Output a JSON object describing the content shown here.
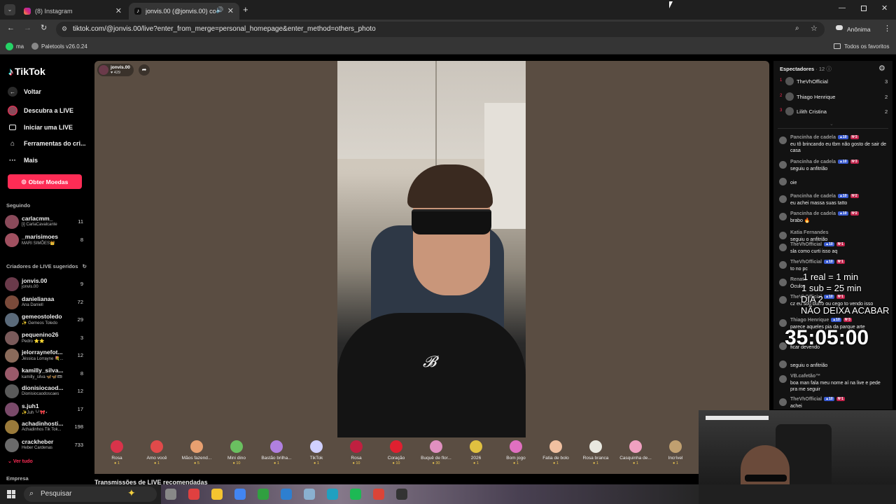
{
  "browser": {
    "tabs": [
      {
        "title": "(8) Instagram"
      },
      {
        "title": "jonvis.00 (@jonvis.00) com"
      }
    ],
    "url": "tiktok.com/@jonvis.00/live?enter_from_merge=personal_homepage&enter_method=others_photo",
    "profile_label": "Anônima",
    "bookmarks": [
      "ma",
      "Paletools v26.0.24"
    ],
    "all_bookmarks_label": "Todos os favoritos"
  },
  "sidebar": {
    "logo": "TikTok",
    "back_label": "Voltar",
    "nav": [
      {
        "label": "Descubra a LIVE",
        "icon": "live-avatar-icon"
      },
      {
        "label": "Iniciar uma LIVE",
        "icon": "camera-icon"
      },
      {
        "label": "Ferramentas do cri...",
        "icon": "home-icon"
      },
      {
        "label": "Mais",
        "icon": "more-icon"
      }
    ],
    "coins_button": "Obter Moedas",
    "following_title": "Seguindo",
    "following": [
      {
        "name": "carlacmm_",
        "sub": "[i] CarlaCavalcante",
        "count": "11",
        "color": "#8a4a5a"
      },
      {
        "name": "_marisimoes",
        "sub": "MARI SIMÕES👑",
        "count": "8",
        "color": "#a05060"
      }
    ],
    "suggested_title": "Criadores de LIVE sugeridos",
    "suggested": [
      {
        "name": "jonvis.00",
        "sub": "jonvis.00",
        "count": "9",
        "color": "#6a3a4a"
      },
      {
        "name": "danielianaa",
        "sub": "Ana Daniell",
        "count": "72",
        "color": "#7a4a3a"
      },
      {
        "name": "gemeostoledo",
        "sub": "✨ Gemeos Toledo",
        "count": "29",
        "color": "#5a6a7a"
      },
      {
        "name": "pequenino26",
        "sub": "Pedro ⭐⭐",
        "count": "3",
        "color": "#7a5a5a"
      },
      {
        "name": "jelorraynefot...",
        "sub": "Jéssica Lorrayne 💐...",
        "count": "12",
        "color": "#8a6a5a"
      },
      {
        "name": "kamilly_silva...",
        "sub": "kamilly_silva 🦋🦋🎟",
        "count": "8",
        "color": "#9a5a6a"
      },
      {
        "name": "dionisiocaod...",
        "sub": "Dionisiocaodoscaes",
        "count": "12",
        "color": "#5a5a5a"
      },
      {
        "name": "s.juh1",
        "sub": "✨Juh ╰╯🎀⋆",
        "count": "17",
        "color": "#7a4a6a"
      },
      {
        "name": "achadinhosti...",
        "sub": "Achadinhos Tik Tok...",
        "count": "198",
        "color": "#9a7a3a"
      },
      {
        "name": "crackheber",
        "sub": "Heber Cardenas",
        "count": "733",
        "color": "#6a6a6a"
      }
    ],
    "see_all": "Ver tudo",
    "company": "Empresa"
  },
  "stream": {
    "host_name": "jonvis.00",
    "host_likes": "429",
    "gifts": [
      {
        "name": "Rosa",
        "price": "1",
        "color": "#d8334a"
      },
      {
        "name": "Amo você",
        "price": "1",
        "color": "#e04a4a"
      },
      {
        "name": "Mãos fazend...",
        "price": "5",
        "color": "#e8a070"
      },
      {
        "name": "Mini dino",
        "price": "10",
        "color": "#6ac060"
      },
      {
        "name": "Bastão brilha...",
        "price": "1",
        "color": "#b080e0"
      },
      {
        "name": "TikTok",
        "price": "1",
        "color": "#d0d0ff"
      },
      {
        "name": "Rosa",
        "price": "10",
        "color": "#c02040"
      },
      {
        "name": "Coração",
        "price": "10",
        "color": "#e02030"
      },
      {
        "name": "Buquê de flor...",
        "price": "30",
        "color": "#e090c0"
      },
      {
        "name": "2026",
        "price": "1",
        "color": "#e0c040"
      },
      {
        "name": "Bom jogo",
        "price": "1",
        "color": "#e070c0"
      },
      {
        "name": "Fatia de bolo",
        "price": "1",
        "color": "#f0c0a0"
      },
      {
        "name": "Rosa branca",
        "price": "1",
        "color": "#e8e8e0"
      },
      {
        "name": "Casquinha de...",
        "price": "1",
        "color": "#f0a0c0"
      },
      {
        "name": "Incrível",
        "price": "1",
        "color": "#c0a070"
      }
    ],
    "recommended_title": "Transmissões de LIVE recomendadas"
  },
  "viewers": {
    "title": "Espectadores",
    "count": "12",
    "top": [
      {
        "rank": "1",
        "name": "TheVhOfficial",
        "score": "3"
      },
      {
        "rank": "2",
        "name": "Thiago Henrique",
        "score": "2"
      },
      {
        "rank": "3",
        "name": "Lilith Cristina",
        "score": "2"
      }
    ]
  },
  "chat": [
    {
      "user": "Pancinha de cadela",
      "badge": "Nº3",
      "text": "eu tô brincando eu tbm não gosto de sair de casa"
    },
    {
      "user": "Pancinha de cadela",
      "badge": "Nº3",
      "text": "seguiu o anfitrião"
    },
    {
      "user": "",
      "badge": "",
      "text": "oie"
    },
    {
      "user": "Pancinha de cadela",
      "badge": "Nº2",
      "text": "eu achei massa suas tatto"
    },
    {
      "user": "Pancinha de cadela",
      "badge": "Nº2",
      "text": "brabo 🔥"
    },
    {
      "user": "Katia Fernandes",
      "badge": "",
      "text": "seguiu o anfitrião"
    },
    {
      "user": "TheVhOfficial",
      "badge": "Nº1",
      "text": "sla como curti isso aq"
    },
    {
      "user": "TheVhOfficial",
      "badge": "Nº1",
      "text": "to no pc"
    },
    {
      "user": "Renato",
      "badge": "",
      "text": "Óculos"
    },
    {
      "user": "TheVhOfficial",
      "badge": "Nº1",
      "text": "cz eu sou burro ou cego to vendo isso"
    },
    {
      "user": "Thiago Henrique",
      "badge": "Nº3",
      "text": "parece aqueles pia da parque arte"
    },
    {
      "user": "",
      "badge": "",
      "text": "ficar devendo"
    },
    {
      "user": "",
      "badge": "",
      "text": "seguiu o anfitrião"
    },
    {
      "user": "VB.cafetão™",
      "badge": "",
      "text": "boa man fala meu nome aí na live e pede pra me seguir"
    },
    {
      "user": "TheVhOfficial",
      "badge": "Nº1",
      "text": "achei"
    }
  ],
  "overlay": {
    "line1": "1 real = 1 min",
    "line2": "1 sub = 25 min",
    "line3": "DIA 2",
    "line4": "NÃO DEIXA ACABAR",
    "timer": "35:05:00"
  },
  "taskbar": {
    "search_placeholder": "Pesquisar"
  }
}
